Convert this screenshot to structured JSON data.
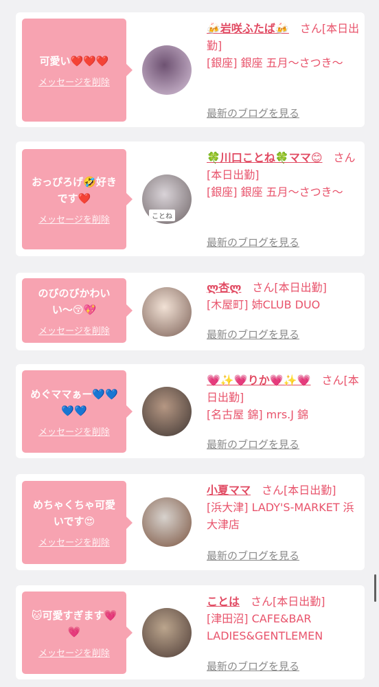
{
  "delete_label": "メッセージを削除",
  "blog_label": "最新のブログを見る",
  "messages": [
    {
      "text": "可愛い❤️❤️❤️",
      "name": "🍻岩咲ふたば🍻",
      "suffix": "さん[本日出勤]",
      "location": "[銀座] 銀座 五月〜さつき〜",
      "avatar_colors": [
        "#6e5272",
        "#d7c3d9"
      ]
    },
    {
      "text": "おっぴろげ🤣好きです❤️",
      "name": "🍀川口ことね🍀ママ😊",
      "suffix": "さん[本日出勤]",
      "location": "[銀座] 銀座 五月〜さつき〜",
      "avatar_colors": [
        "#d9d3d8",
        "#6f6567"
      ],
      "avatar_text": "ことね"
    },
    {
      "text": "のびのびかわいい〜😚💖",
      "name": "ლ杏ლ",
      "suffix": "さん[本日出勤]",
      "location": "[木屋町] 姉CLUB DUO",
      "avatar_colors": [
        "#f1e1d5",
        "#7c6157"
      ]
    },
    {
      "text": "めぐママぁー💙💙💙💙",
      "name": "💗✨💗りか💗✨💗",
      "suffix": "さん[本日出勤]",
      "location": "[名古屋 錦] mrs.J 錦",
      "avatar_colors": [
        "#b59783",
        "#3e3532"
      ]
    },
    {
      "text": "めちゃくちゃ可愛いです😍",
      "name": "小夏ママ",
      "suffix": "さん[本日出勤]",
      "location": "[浜大津] LADY'S-MARKET 浜大津店",
      "avatar_colors": [
        "#d7d2cd",
        "#7b5440"
      ]
    },
    {
      "text": "🐱可愛すぎます💗💗",
      "name": "ことは",
      "suffix": "さん[本日出勤]",
      "location": "[津田沼] CAFE&BAR LADIES&GENTLEMEN",
      "avatar_colors": [
        "#bba58d",
        "#4d3b36"
      ]
    }
  ]
}
